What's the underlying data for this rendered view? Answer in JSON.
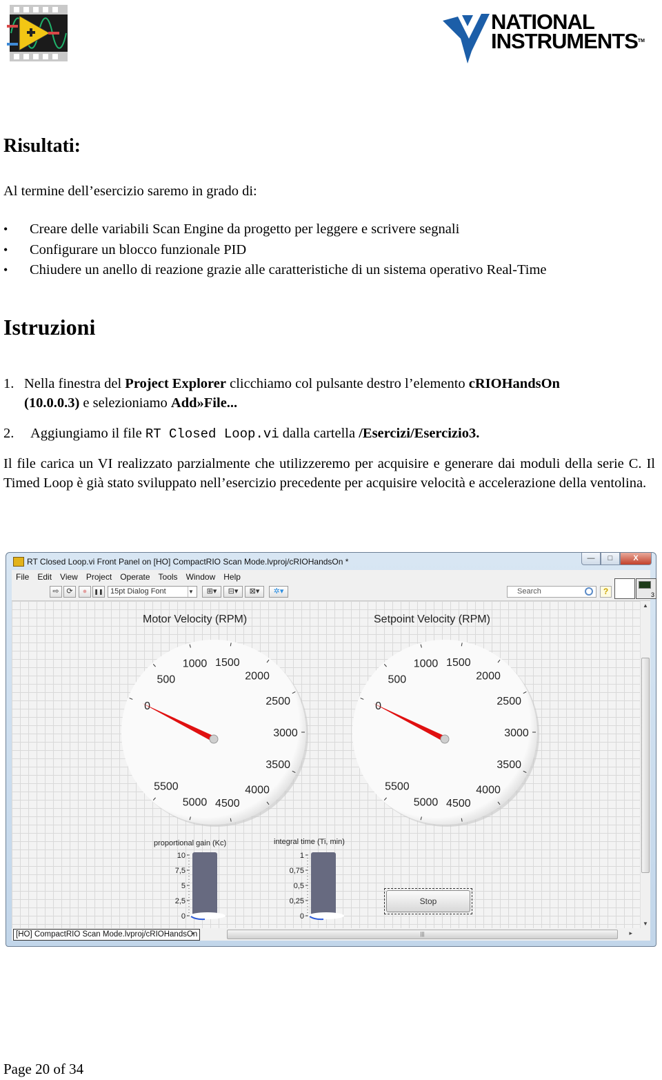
{
  "header": {
    "left_logo": "labview-logo-icon",
    "right_logo_line1": "NATIONAL",
    "right_logo_line2": "INSTRUMENTS",
    "right_logo_tm": "TM"
  },
  "results": {
    "heading": "Risultati:",
    "intro": "Al termine dell’esercizio saremo in grado di:",
    "bullets": [
      "Creare delle variabili Scan Engine da progetto per leggere e scrivere segnali",
      "Configurare un blocco funzionale PID",
      "Chiudere un anello di reazione grazie alle caratteristiche di un sistema operativo Real-Time"
    ]
  },
  "instructions": {
    "heading": "Istruzioni",
    "step1": {
      "num": "1.",
      "t1": "Nella finestra del ",
      "b1": "Project Explorer",
      "t2": " clicchiamo col pulsante destro l’elemento ",
      "b2": "cRIOHandsOn",
      "b3": "(10.0.0.3)",
      "t3": " e selezioniamo ",
      "b4": "Add»File..."
    },
    "step2": {
      "num": "2.",
      "t1": "Aggiungiamo il file ",
      "code": "RT Closed Loop.vi",
      "t2": " dalla cartella ",
      "b1": "/Esercizi/Esercizio3."
    },
    "paragraph": "Il file carica un VI realizzato parzialmente che utilizzeremo per acquisire e generare dai moduli della serie C. Il  Timed Loop è già stato sviluppato nell’esercizio precedente per acquisire velocità e accelerazione della ventolina."
  },
  "window": {
    "title": "RT Closed Loop.vi Front Panel on [HO] CompactRIO Scan Mode.lvproj/cRIOHandsOn *",
    "buttons": {
      "minimize": "—",
      "maximize": "□",
      "close": "X"
    },
    "menu": [
      "File",
      "Edit",
      "View",
      "Project",
      "Operate",
      "Tools",
      "Window",
      "Help"
    ],
    "toolbar": {
      "run": "⇨",
      "run_continuously": "⟳",
      "abort": "●",
      "pause": "❚❚",
      "font": "15pt Dialog Font",
      "align": "▾",
      "distribute": "▾",
      "resize": "▾",
      "reorder": "▾"
    },
    "search_placeholder": "Search",
    "help": "?",
    "vi_icon_number": "3",
    "status_context": "[HO] CompactRIO Scan Mode.lvproj/cRIOHandsOn",
    "gauges": [
      {
        "title": "Motor Velocity (RPM)",
        "min": 0,
        "max": 6000,
        "ticks": [
          "0",
          "500",
          "1000",
          "1500",
          "2000",
          "2500",
          "3000",
          "3500",
          "4000",
          "4500",
          "5000",
          "5500"
        ],
        "value": 0
      },
      {
        "title": "Setpoint Velocity (RPM)",
        "min": 0,
        "max": 6000,
        "ticks": [
          "0",
          "500",
          "1000",
          "1500",
          "2000",
          "2500",
          "3000",
          "3500",
          "4000",
          "4500",
          "5000",
          "5500"
        ],
        "value": 0
      }
    ],
    "sliders": [
      {
        "label": "proportional gain (Kc)",
        "ticks": [
          "10",
          "7,5",
          "5",
          "2,5",
          "0"
        ],
        "value_fraction": 0
      },
      {
        "label": "integral time (Ti, min)",
        "ticks": [
          "1",
          "0,75",
          "0,5",
          "0,25",
          "0"
        ],
        "value_fraction": 0
      }
    ],
    "stop_label": "Stop",
    "colors": {
      "needle": "#e01010",
      "slider_fill": "#676a80",
      "window_frame": "#c7d9ec"
    }
  },
  "footer": {
    "page": "Page 20 of 34"
  }
}
